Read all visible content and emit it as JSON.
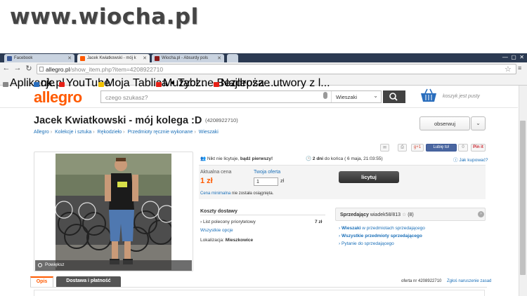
{
  "watermark": "www.wiocha.pl",
  "browser": {
    "tabs": [
      {
        "label": "Facebook",
        "fav": "#3b5998"
      },
      {
        "label": "Jacek Kwiatkowski - mój k",
        "fav": "#ff5a00"
      },
      {
        "label": "Wiocha.pl - Absurdy pols",
        "fav": "#8b1a1a"
      }
    ],
    "url": {
      "host": "allegro.pl",
      "path": "/show_item.php?item=4208922710"
    },
    "bookmarks": [
      {
        "label": "Aplikacje",
        "color": "#888"
      },
      {
        "label": "nk.pl",
        "color": "#2a6ebd"
      },
      {
        "label": "YouTube",
        "color": "#e62117"
      },
      {
        "label": "Moja Tablica • Tabl...",
        "color": "#f2c200"
      },
      {
        "label": "Muzyczne Bezdroża ...",
        "color": "#e62117"
      },
      {
        "label": "Najlepsze utwory z l...",
        "color": "#e62117"
      }
    ]
  },
  "header": {
    "logo": "allegro",
    "search_placeholder": "czego szukasz?",
    "category": "Wieszaki",
    "basket": "koszyk jest pusty"
  },
  "item": {
    "title": "Jacek Kwiatkowski - mój kolega :D",
    "number": "(4208922710)",
    "breadcrumb": [
      "Allegro",
      "Kolekcje i sztuka",
      "Rękodzieło",
      "Przedmioty ręcznie wykonane",
      "Wieszaki"
    ],
    "watch_label": "obserwuj",
    "enlarge": "Powiększ"
  },
  "social": {
    "g1": "g+1",
    "like": "Lubię to!",
    "like_count": "0",
    "pin": "Pin it"
  },
  "bidding": {
    "bids_prefix": "Nikt nie licytuje,",
    "bids_strong": "bądź pierwszy!",
    "time_strong": "2 dni",
    "time_rest": "do końca ( 6 maja, 21:03:55)",
    "how_buy": "Jak kupować?",
    "current_label": "Aktualna cena",
    "current_price": "1 zł",
    "bid_label": "Twoja oferta",
    "bid_value": "1",
    "bid_unit": "zł",
    "bid_button": "licytuj",
    "min_price_link": "Cena minimalna",
    "min_price_rest": "nie została osiągnięta."
  },
  "shipping": {
    "title": "Koszty dostawy",
    "method": "List polecony priorytetowy",
    "cost": "7 zł",
    "all": "Wszystkie opcje",
    "location_label": "Lokalizacja:",
    "location": "Mieszkowice"
  },
  "seller": {
    "label": "Sprzedający",
    "name": "wiadek58/813",
    "rating": "(8)",
    "links": [
      {
        "strong": "Wieszaki",
        "rest": "w przedmiotach sprzedającego"
      },
      {
        "strong": "Wszystkie przedmioty sprzedającego",
        "rest": ""
      },
      {
        "strong": "",
        "rest": "Pytanie do sprzedającego"
      }
    ]
  },
  "bottom": {
    "tab_desc": "Opis",
    "tab_delivery": "Dostawa i płatność",
    "offer_no": "oferta nr 4208922710",
    "report": "Zgłoś naruszenie zasad"
  },
  "colors": {
    "accent": "#ff5a00",
    "link": "#1a6fb8"
  }
}
